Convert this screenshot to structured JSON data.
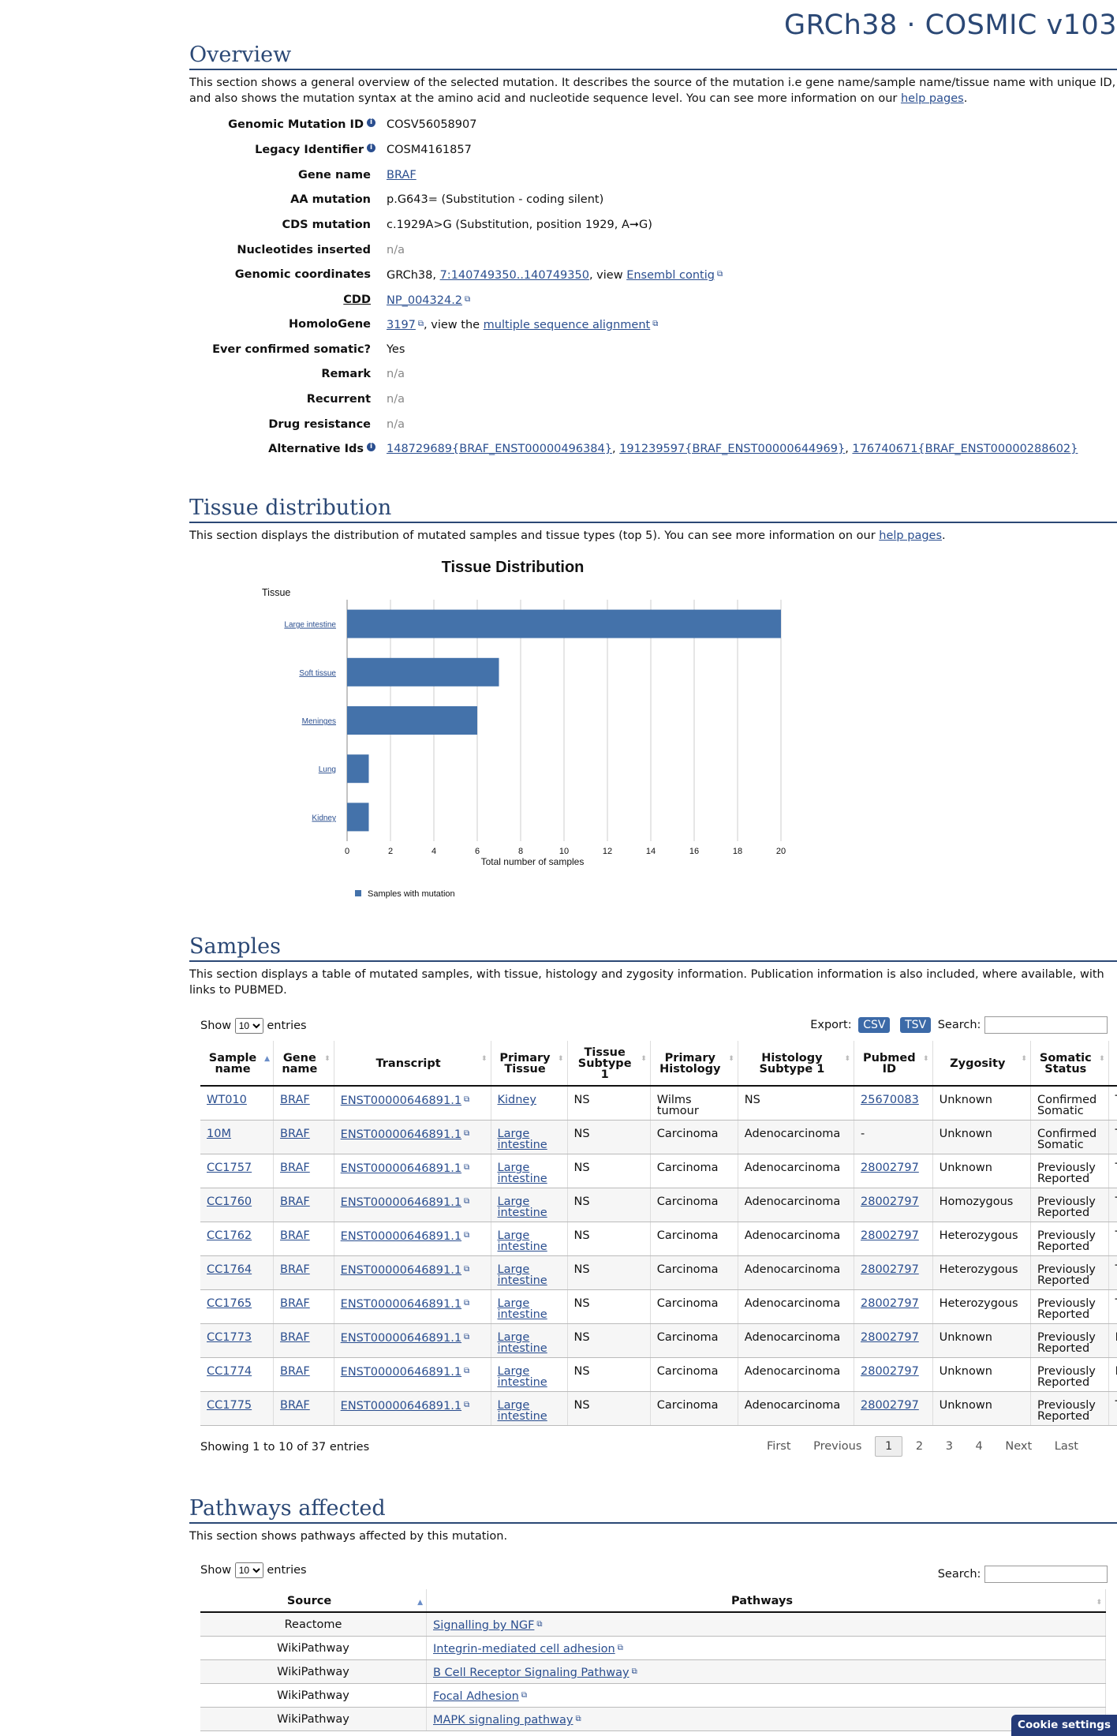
{
  "brand": "GRCh38 · COSMIC v103",
  "overview": {
    "title": "Overview",
    "desc_pre": "This section shows a general overview of the selected mutation. It describes the source of the mutation i.e gene name/sample name/tissue name with unique ID, and also shows the mutation syntax at the amino acid and nucleotide sequence level. You can see more information on our ",
    "desc_link": "help pages",
    "desc_post": ".",
    "rows": {
      "genomic_mutation_id": {
        "label": "Genomic Mutation ID",
        "value": "COSV56058907"
      },
      "legacy_identifier": {
        "label": "Legacy Identifier",
        "value": "COSM4161857"
      },
      "gene_name": {
        "label": "Gene name",
        "value": "BRAF"
      },
      "aa_mutation": {
        "label": "AA mutation",
        "value": "p.G643= (Substitution - coding silent)"
      },
      "cds_mutation": {
        "label": "CDS mutation",
        "value": "c.1929A>G (Substitution, position 1929, A➞G)"
      },
      "nucleotides_inserted": {
        "label": "Nucleotides inserted",
        "value": "n/a"
      },
      "genomic_coordinates": {
        "label": "Genomic coordinates",
        "prefix": "GRCh38, ",
        "link": "7:140749350..140749350",
        "middle": ", view ",
        "link2": "Ensembl contig"
      },
      "cdd": {
        "label": "CDD",
        "link": "NP_004324.2"
      },
      "homologene": {
        "label": "HomoloGene",
        "link": "3197",
        "middle": ", view the ",
        "link2": "multiple sequence alignment"
      },
      "ever_confirmed": {
        "label": "Ever confirmed somatic?",
        "value": "Yes"
      },
      "remark": {
        "label": "Remark",
        "value": "n/a"
      },
      "recurrent": {
        "label": "Recurrent",
        "value": "n/a"
      },
      "drug_resistance": {
        "label": "Drug resistance",
        "value": "n/a"
      },
      "alternative_ids": {
        "label": "Alternative Ids",
        "ids": [
          "148729689{BRAF_ENST00000496384}",
          "191239597{BRAF_ENST00000644969}",
          "176740671{BRAF_ENST00000288602}"
        ]
      }
    }
  },
  "tissue": {
    "title": "Tissue distribution",
    "desc_pre": "This section displays the distribution of mutated samples and tissue types (top 5). You can see more information on our ",
    "desc_link": "help pages",
    "desc_post": "."
  },
  "chart_data": {
    "type": "bar",
    "orientation": "horizontal",
    "title": "Tissue Distribution",
    "ylabel": "Tissue",
    "xlabel": "Total number of samples",
    "categories": [
      "Large intestine",
      "Soft tissue",
      "Meninges",
      "Lung",
      "Kidney"
    ],
    "series": [
      {
        "name": "Samples with mutation",
        "values": [
          20,
          7,
          6,
          1,
          1
        ]
      }
    ],
    "xlim": [
      0,
      20
    ],
    "xticks": [
      0,
      2,
      4,
      6,
      8,
      10,
      12,
      14,
      16,
      18,
      20
    ],
    "grid": true,
    "legend": "bottom-left",
    "color": "#4472aa"
  },
  "samples": {
    "title": "Samples",
    "desc": "This section displays a table of mutated samples, with tissue, histology and zygosity information. Publication information is also included, where available, with links to PUBMED.",
    "show_label": "Show",
    "entries_label": "entries",
    "page_size": "10",
    "export_label": "Export:",
    "csv": "CSV",
    "tsv": "TSV",
    "search_label": "Search:",
    "headers": [
      "Sample name",
      "Gene name",
      "Transcript",
      "Primary Tissue",
      "Tissue Subtype 1",
      "Primary Histology",
      "Histology Subtype 1",
      "Pubmed ID",
      "Zygosity",
      "Somatic Status",
      "T"
    ],
    "rows": [
      {
        "sample": "WT010",
        "gene": "BRAF",
        "transcript": "ENST00000646891.1",
        "tissue": "Kidney",
        "subtype": "NS",
        "histology": "Wilms tumour",
        "hsub": "NS",
        "pubmed": "25670083",
        "zyg": "Unknown",
        "status": "Confirmed Somatic",
        "extra": "T S"
      },
      {
        "sample": "10M",
        "gene": "BRAF",
        "transcript": "ENST00000646891.1",
        "tissue": "Large intestine",
        "subtype": "NS",
        "histology": "Carcinoma",
        "hsub": "Adenocarcinoma",
        "pubmed": "-",
        "zyg": "Unknown",
        "status": "Confirmed Somatic",
        "extra": "T S"
      },
      {
        "sample": "CC1757",
        "gene": "BRAF",
        "transcript": "ENST00000646891.1",
        "tissue": "Large intestine",
        "subtype": "NS",
        "histology": "Carcinoma",
        "hsub": "Adenocarcinoma",
        "pubmed": "28002797",
        "zyg": "Unknown",
        "status": "Previously Reported",
        "extra": "T S"
      },
      {
        "sample": "CC1760",
        "gene": "BRAF",
        "transcript": "ENST00000646891.1",
        "tissue": "Large intestine",
        "subtype": "NS",
        "histology": "Carcinoma",
        "hsub": "Adenocarcinoma",
        "pubmed": "28002797",
        "zyg": "Homozygous",
        "status": "Previously Reported",
        "extra": "T S"
      },
      {
        "sample": "CC1762",
        "gene": "BRAF",
        "transcript": "ENST00000646891.1",
        "tissue": "Large intestine",
        "subtype": "NS",
        "histology": "Carcinoma",
        "hsub": "Adenocarcinoma",
        "pubmed": "28002797",
        "zyg": "Heterozygous",
        "status": "Previously Reported",
        "extra": "T S"
      },
      {
        "sample": "CC1764",
        "gene": "BRAF",
        "transcript": "ENST00000646891.1",
        "tissue": "Large intestine",
        "subtype": "NS",
        "histology": "Carcinoma",
        "hsub": "Adenocarcinoma",
        "pubmed": "28002797",
        "zyg": "Heterozygous",
        "status": "Previously Reported",
        "extra": "T S"
      },
      {
        "sample": "CC1765",
        "gene": "BRAF",
        "transcript": "ENST00000646891.1",
        "tissue": "Large intestine",
        "subtype": "NS",
        "histology": "Carcinoma",
        "hsub": "Adenocarcinoma",
        "pubmed": "28002797",
        "zyg": "Heterozygous",
        "status": "Previously Reported",
        "extra": "T S"
      },
      {
        "sample": "CC1773",
        "gene": "BRAF",
        "transcript": "ENST00000646891.1",
        "tissue": "Large intestine",
        "subtype": "NS",
        "histology": "Carcinoma",
        "hsub": "Adenocarcinoma",
        "pubmed": "28002797",
        "zyg": "Unknown",
        "status": "Previously Reported",
        "extra": "N"
      },
      {
        "sample": "CC1774",
        "gene": "BRAF",
        "transcript": "ENST00000646891.1",
        "tissue": "Large intestine",
        "subtype": "NS",
        "histology": "Carcinoma",
        "hsub": "Adenocarcinoma",
        "pubmed": "28002797",
        "zyg": "Unknown",
        "status": "Previously Reported",
        "extra": "N"
      },
      {
        "sample": "CC1775",
        "gene": "BRAF",
        "transcript": "ENST00000646891.1",
        "tissue": "Large intestine",
        "subtype": "NS",
        "histology": "Carcinoma",
        "hsub": "Adenocarcinoma",
        "pubmed": "28002797",
        "zyg": "Unknown",
        "status": "Previously Reported",
        "extra": "T S"
      }
    ],
    "info": "Showing 1 to 10 of 37 entries",
    "pager": {
      "first": "First",
      "previous": "Previous",
      "pages": [
        "1",
        "2",
        "3",
        "4"
      ],
      "next": "Next",
      "last": "Last",
      "current": "1"
    }
  },
  "pathways": {
    "title": "Pathways affected",
    "desc": "This section shows pathways affected by this mutation.",
    "show_label": "Show",
    "entries_label": "entries",
    "page_size": "10",
    "search_label": "Search:",
    "headers": [
      "Source",
      "Pathways"
    ],
    "rows": [
      {
        "source": "Reactome",
        "pathway": "Signalling by NGF"
      },
      {
        "source": "WikiPathway",
        "pathway": "Integrin-mediated cell adhesion"
      },
      {
        "source": "WikiPathway",
        "pathway": "B Cell Receptor Signaling Pathway"
      },
      {
        "source": "WikiPathway",
        "pathway": "Focal Adhesion"
      },
      {
        "source": "WikiPathway",
        "pathway": "MAPK signaling pathway"
      }
    ]
  },
  "cookie": "Cookie settings"
}
